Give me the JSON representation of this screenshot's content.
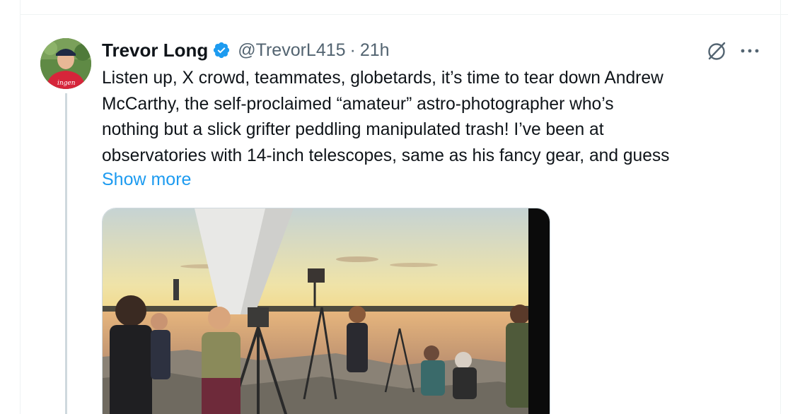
{
  "tweet": {
    "author": {
      "display_name": "Trevor Long",
      "handle": "@TrevorL415",
      "verified": true
    },
    "separator": "·",
    "timestamp": "21h",
    "text_lines": [
      "Listen up, X crowd, teammates, globetards, it’s time to tear down Andrew",
      "McCarthy, the self-proclaimed “amateur” astro-photographer who’s",
      "nothing but a slick grifter peddling manipulated trash! I’ve been at",
      "observatories with 14-inch telescopes, same as his fancy gear, and guess"
    ],
    "show_more": "Show more",
    "actions": {
      "grok_icon": "grok-icon",
      "more_icon": "more-horizontal-icon"
    },
    "media": {
      "kind": "photo",
      "colors": {
        "sky_top": "#c9d6d8",
        "sky_mid": "#f5d77a",
        "horizon": "#f2a74a",
        "water": "#d9a070",
        "rocks": "#8a8276"
      }
    }
  },
  "colors": {
    "accent": "#1d9bf0",
    "text_primary": "#0f1419",
    "text_secondary": "#536471",
    "divider": "#eff3f4"
  }
}
